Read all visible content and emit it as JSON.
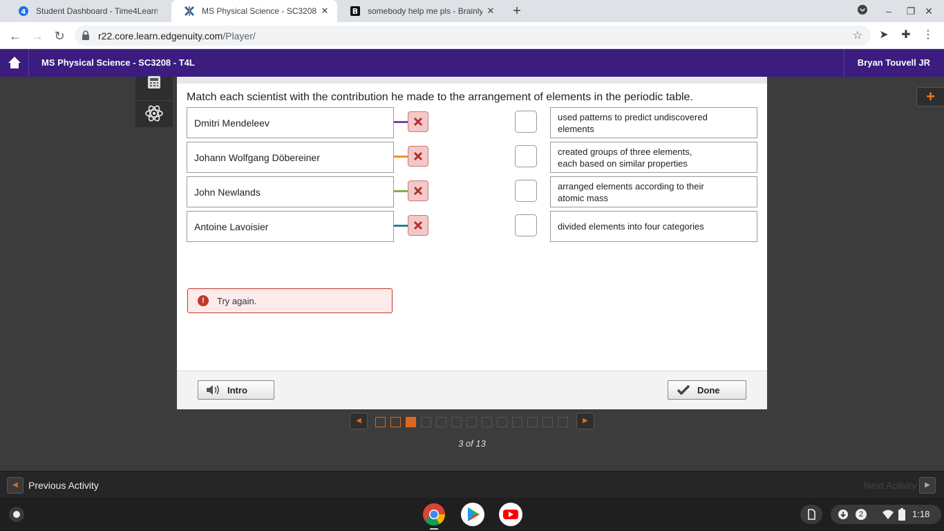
{
  "browser": {
    "tabs": [
      {
        "title": "Student Dashboard - Time4Learn",
        "active": false
      },
      {
        "title": "MS Physical Science - SC3208 - T",
        "active": true
      },
      {
        "title": "somebody help me pls - Brainly.c",
        "active": false
      }
    ],
    "url_host": "r22.core.learn.edgenuity.com",
    "url_path": "/Player/"
  },
  "app": {
    "course_title": "MS Physical Science - SC3208 - T4L",
    "user_name": "Bryan Touvell JR"
  },
  "activity": {
    "prompt": "Match each scientist with the contribution he made to the arrangement of elements in the periodic table.",
    "left_items": [
      {
        "label": "Dmitri Mendeleev",
        "line_color": "#7b3fa6"
      },
      {
        "label": "Johann Wolfgang Döbereiner",
        "line_color": "#f0902a"
      },
      {
        "label": "John Newlands",
        "line_color": "#7cb342"
      },
      {
        "label": "Antoine Lavoisier",
        "line_color": "#2e7d8c"
      }
    ],
    "right_items": [
      {
        "line1": "used patterns to predict undiscovered",
        "line2": "elements"
      },
      {
        "line1": "created groups of three elements,",
        "line2": "each based on similar properties"
      },
      {
        "line1": "arranged elements according to their",
        "line2": "atomic mass"
      },
      {
        "line1": "divided elements into four categories",
        "line2": ""
      }
    ],
    "feedback": "Try again.",
    "intro_label": "Intro",
    "done_label": "Done"
  },
  "pager": {
    "current": 3,
    "total": 13,
    "label": "3 of 13"
  },
  "activity_nav": {
    "previous_label": "Previous Activity",
    "next_label": "Next Activity"
  },
  "shelf": {
    "notification_count": "2",
    "time": "1:18"
  }
}
